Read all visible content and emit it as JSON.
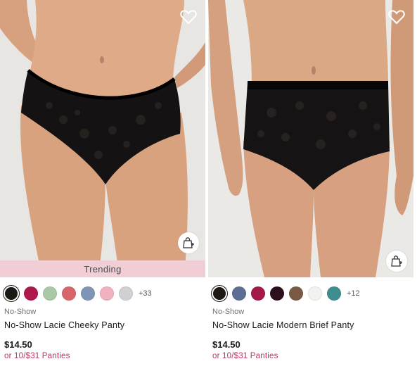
{
  "products": [
    {
      "badge": "Trending",
      "category": "No-Show",
      "name": "No-Show Lacie Cheeky Panty",
      "price": "$14.50",
      "promo": "or 10/$31 Panties",
      "more_colors": "+33",
      "swatch_colors": [
        "#1c1814",
        "#b0174a",
        "#a9c9a6",
        "#d9656c",
        "#7f95b5",
        "#efb2be",
        "#cfd0d3"
      ],
      "icons": [
        "heart-icon",
        "shopping-bag-icon"
      ]
    },
    {
      "category": "No-Show",
      "name": "No-Show Lacie Modern Brief Panty",
      "price": "$14.50",
      "promo": "or 10/$31 Panties",
      "more_colors": "+12",
      "swatch_colors": [
        "#1c1814",
        "#5c6e93",
        "#a4184b",
        "#2c0f1c",
        "#7a5a45",
        "#f4f2ee",
        "#3f8d8e"
      ],
      "icons": [
        "heart-icon",
        "shopping-bag-icon"
      ]
    }
  ],
  "colors": {
    "promo": "#c22c63",
    "trending_bg": "#f1cdd6"
  }
}
